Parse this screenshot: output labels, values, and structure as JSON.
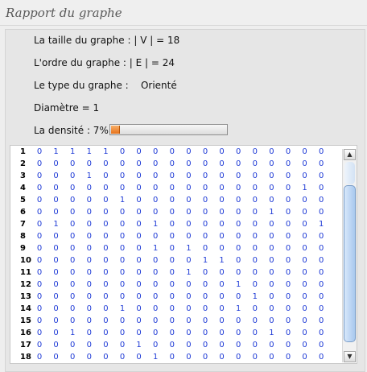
{
  "window": {
    "title": "Rapport du graphe"
  },
  "info": {
    "size": "La taille du graphe : | V | = 18",
    "order": "L'ordre du graphe : | E | = 24",
    "type": "Le type du graphe :    Orienté",
    "diameter": "Diamètre = 1",
    "density_label": "La densité : 7%",
    "density_value": 0.07
  },
  "matrix": {
    "row_labels": [
      "1",
      "2",
      "3",
      "4",
      "5",
      "6",
      "7",
      "8",
      "9",
      "10",
      "11",
      "12",
      "13",
      "14",
      "15",
      "16",
      "17",
      "18"
    ],
    "rows": [
      [
        0,
        1,
        1,
        1,
        1,
        0,
        0,
        0,
        0,
        0,
        0,
        0,
        0,
        0,
        0,
        0,
        0,
        0
      ],
      [
        0,
        0,
        0,
        0,
        0,
        0,
        0,
        0,
        0,
        0,
        0,
        0,
        0,
        0,
        0,
        0,
        0,
        0
      ],
      [
        0,
        0,
        0,
        1,
        0,
        0,
        0,
        0,
        0,
        0,
        0,
        0,
        0,
        0,
        0,
        0,
        0,
        0
      ],
      [
        0,
        0,
        0,
        0,
        0,
        0,
        0,
        0,
        0,
        0,
        0,
        0,
        0,
        0,
        0,
        0,
        1,
        0
      ],
      [
        0,
        0,
        0,
        0,
        0,
        1,
        0,
        0,
        0,
        0,
        0,
        0,
        0,
        0,
        0,
        0,
        0,
        0
      ],
      [
        0,
        0,
        0,
        0,
        0,
        0,
        0,
        0,
        0,
        0,
        0,
        0,
        0,
        0,
        1,
        0,
        0,
        0
      ],
      [
        0,
        1,
        0,
        0,
        0,
        0,
        0,
        1,
        0,
        0,
        0,
        0,
        0,
        0,
        0,
        0,
        0,
        1
      ],
      [
        0,
        0,
        0,
        0,
        0,
        0,
        0,
        0,
        0,
        0,
        0,
        0,
        0,
        0,
        0,
        0,
        0,
        0
      ],
      [
        0,
        0,
        0,
        0,
        0,
        0,
        0,
        1,
        0,
        1,
        0,
        0,
        0,
        0,
        0,
        0,
        0,
        0
      ],
      [
        0,
        0,
        0,
        0,
        0,
        0,
        0,
        0,
        0,
        0,
        1,
        1,
        0,
        0,
        0,
        0,
        0,
        0
      ],
      [
        0,
        0,
        0,
        0,
        0,
        0,
        0,
        0,
        0,
        1,
        0,
        0,
        0,
        0,
        0,
        0,
        0,
        0
      ],
      [
        0,
        0,
        0,
        0,
        0,
        0,
        0,
        0,
        0,
        0,
        0,
        0,
        1,
        0,
        0,
        0,
        0,
        0
      ],
      [
        0,
        0,
        0,
        0,
        0,
        0,
        0,
        0,
        0,
        0,
        0,
        0,
        0,
        1,
        0,
        0,
        0,
        0
      ],
      [
        0,
        0,
        0,
        0,
        0,
        1,
        0,
        0,
        0,
        0,
        0,
        0,
        1,
        0,
        0,
        0,
        0,
        0
      ],
      [
        0,
        0,
        0,
        0,
        0,
        0,
        0,
        0,
        0,
        0,
        0,
        0,
        0,
        0,
        0,
        0,
        0,
        0
      ],
      [
        0,
        0,
        1,
        0,
        0,
        0,
        0,
        0,
        0,
        0,
        0,
        0,
        0,
        0,
        1,
        0,
        0,
        0
      ],
      [
        0,
        0,
        0,
        0,
        0,
        0,
        1,
        0,
        0,
        0,
        0,
        0,
        0,
        0,
        0,
        0,
        0,
        0
      ],
      [
        0,
        0,
        0,
        0,
        0,
        0,
        0,
        1,
        0,
        0,
        0,
        0,
        0,
        0,
        0,
        0,
        0,
        0
      ]
    ]
  },
  "scrollbar": {
    "up_icon": "▲",
    "down_icon": "▼"
  }
}
